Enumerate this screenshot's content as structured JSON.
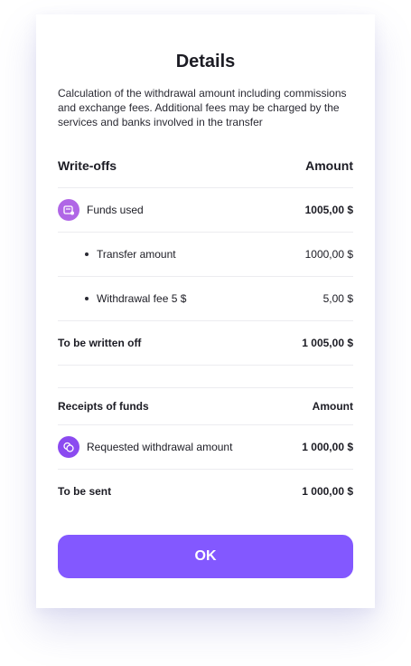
{
  "title": "Details",
  "description": "Calculation of the withdrawal amount including commissions and exchange fees. Additional fees may be charged by the services and banks involved in the transfer",
  "writeoffs": {
    "header_label": "Write-offs",
    "header_amount": "Amount",
    "funds_used": {
      "label": "Funds used",
      "amount": "1005,00 $",
      "icon": "wallet-icon"
    },
    "items": [
      {
        "label": "Transfer amount",
        "amount": "1000,00 $"
      },
      {
        "label": "Withdrawal fee 5 $",
        "amount": "5,00 $"
      }
    ],
    "total_label": "To be written off",
    "total_amount": "1 005,00 $"
  },
  "receipts": {
    "header_label": "Receipts of funds",
    "header_amount": "Amount",
    "requested": {
      "label": "Requested withdrawal amount",
      "amount": "1 000,00 $",
      "icon": "coins-icon"
    },
    "total_label": "To be sent",
    "total_amount": "1 000,00 $"
  },
  "ok_button": "OK",
  "colors": {
    "accent": "#8358ff",
    "icon_purple": "#b066e6",
    "icon_violet": "#8b4af0"
  }
}
